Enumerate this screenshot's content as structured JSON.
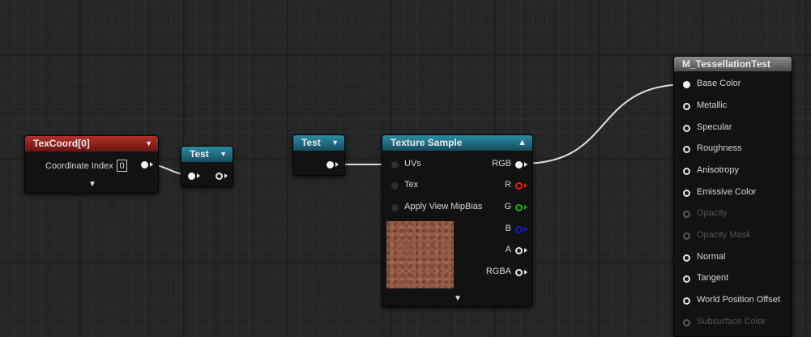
{
  "graph": {
    "texcoord_node": {
      "title": "TexCoord[0]",
      "property_label": "Coordinate Index",
      "property_value": "0",
      "expand_icon": "chevron-down-icon"
    },
    "reroute_node_1": {
      "title": "Test"
    },
    "reroute_node_2": {
      "title": "Test"
    },
    "texture_sample_node": {
      "title": "Texture Sample",
      "inputs": [
        "UVs",
        "Tex",
        "Apply View MipBias"
      ],
      "outputs": [
        "RGB",
        "R",
        "G",
        "B",
        "A",
        "RGBA"
      ],
      "output_colors": {
        "R": "#e01d1d",
        "G": "#16b116",
        "B": "#1b1bd6"
      }
    },
    "material_node": {
      "title": "M_TessellationTest",
      "inputs": [
        "Base Color",
        "Metallic",
        "Specular",
        "Roughness",
        "Anisotropy",
        "Emissive Color",
        "Opacity",
        "Opacity Mask",
        "Normal",
        "Tangent",
        "World Position Offset",
        "Subsurface Color"
      ],
      "disabled_inputs": [
        "Opacity",
        "Opacity Mask",
        "Subsurface Color"
      ]
    },
    "colors": {
      "grid_background": "#262626",
      "texcoord_header": "#b1302b",
      "reroute_header": "#2a8ca3",
      "texture_header": "#2a8ca3",
      "material_header": "#8c8c8c",
      "wire": "#e8e8e8"
    }
  }
}
